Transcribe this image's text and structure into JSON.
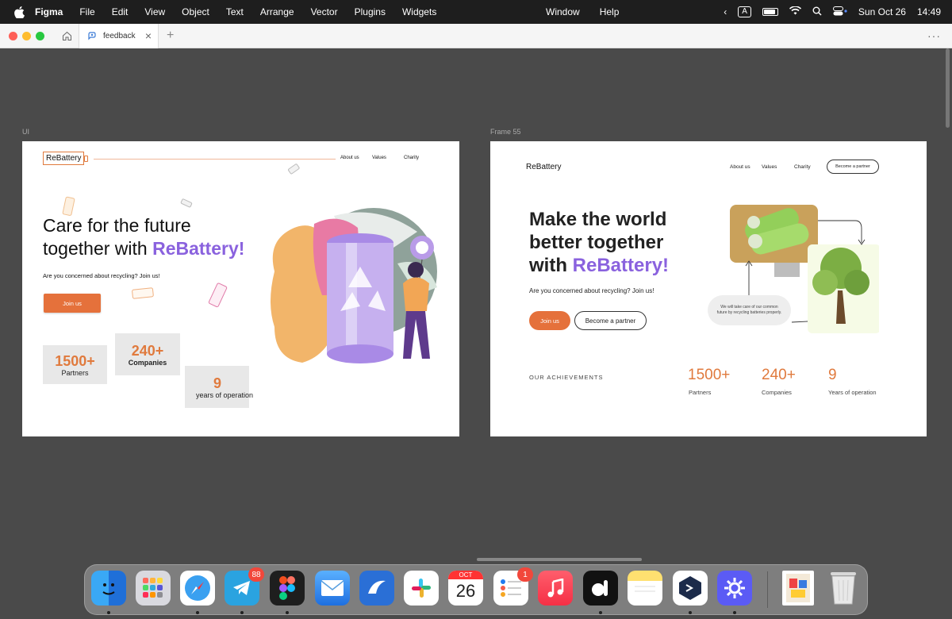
{
  "menubar": {
    "app_name": "Figma",
    "menus": [
      "File",
      "Edit",
      "View",
      "Object",
      "Text",
      "Arrange",
      "Vector",
      "Plugins",
      "Widgets"
    ],
    "center_menus": [
      "Window",
      "Help"
    ],
    "input_source": "A",
    "date": "Sun Oct 26",
    "time": "14:49"
  },
  "tabbar": {
    "tab_title": "feedback",
    "new_tab": "+",
    "more": "···"
  },
  "canvas": {
    "frame1": {
      "label": "UI",
      "logo": "ReBattery",
      "nav": [
        "About us",
        "Values",
        "Charity"
      ],
      "heading_line1": "Care for the future",
      "heading_line2_prefix": "together with ",
      "heading_accent": "ReBattery!",
      "subtitle": "Are you concerned about recycling? Join us!",
      "join_button": "Join us",
      "stats": [
        {
          "value": "1500+",
          "label": "Partners"
        },
        {
          "value": "240+",
          "label": "Companies"
        },
        {
          "value": "9",
          "label": "years of operation"
        }
      ]
    },
    "frame2": {
      "label": "Frame 55",
      "logo": "ReBattery",
      "nav": [
        "About us",
        "Values",
        "Charity"
      ],
      "partner_button_top": "Become a partner",
      "heading_line1": "Make the world",
      "heading_line2": "better together",
      "heading_line3_prefix": "with ",
      "heading_accent": "ReBattery!",
      "subtitle": "Are you concerned about recycling? Join us!",
      "join_button": "Join us",
      "partner_button": "Become a partner",
      "bubble_text": "We will take care of our common future by recycling batteries properly.",
      "achievements_label": "OUR ACHIEVEMENTS",
      "stats": [
        {
          "value": "1500+",
          "label": "Partners"
        },
        {
          "value": "240+",
          "label": "Companies"
        },
        {
          "value": "9",
          "label": "Years of operation"
        }
      ]
    }
  },
  "dock": {
    "apps": [
      "finder-icon",
      "launchpad-icon",
      "safari-icon",
      "telegram-icon",
      "figma-icon",
      "mail-icon",
      "feedback-icon",
      "slack-icon",
      "calendar-icon",
      "reminders-icon",
      "music-icon",
      "codesign-icon",
      "notes-icon",
      "vpn-icon",
      "settings-icon"
    ],
    "telegram_badge": "88",
    "reminders_badge": "1",
    "calendar_month": "OCT",
    "calendar_day": "26"
  },
  "colors": {
    "accent_orange": "#e5713b",
    "accent_purple": "#8a62de",
    "canvas_bg": "#4a4a4a"
  }
}
